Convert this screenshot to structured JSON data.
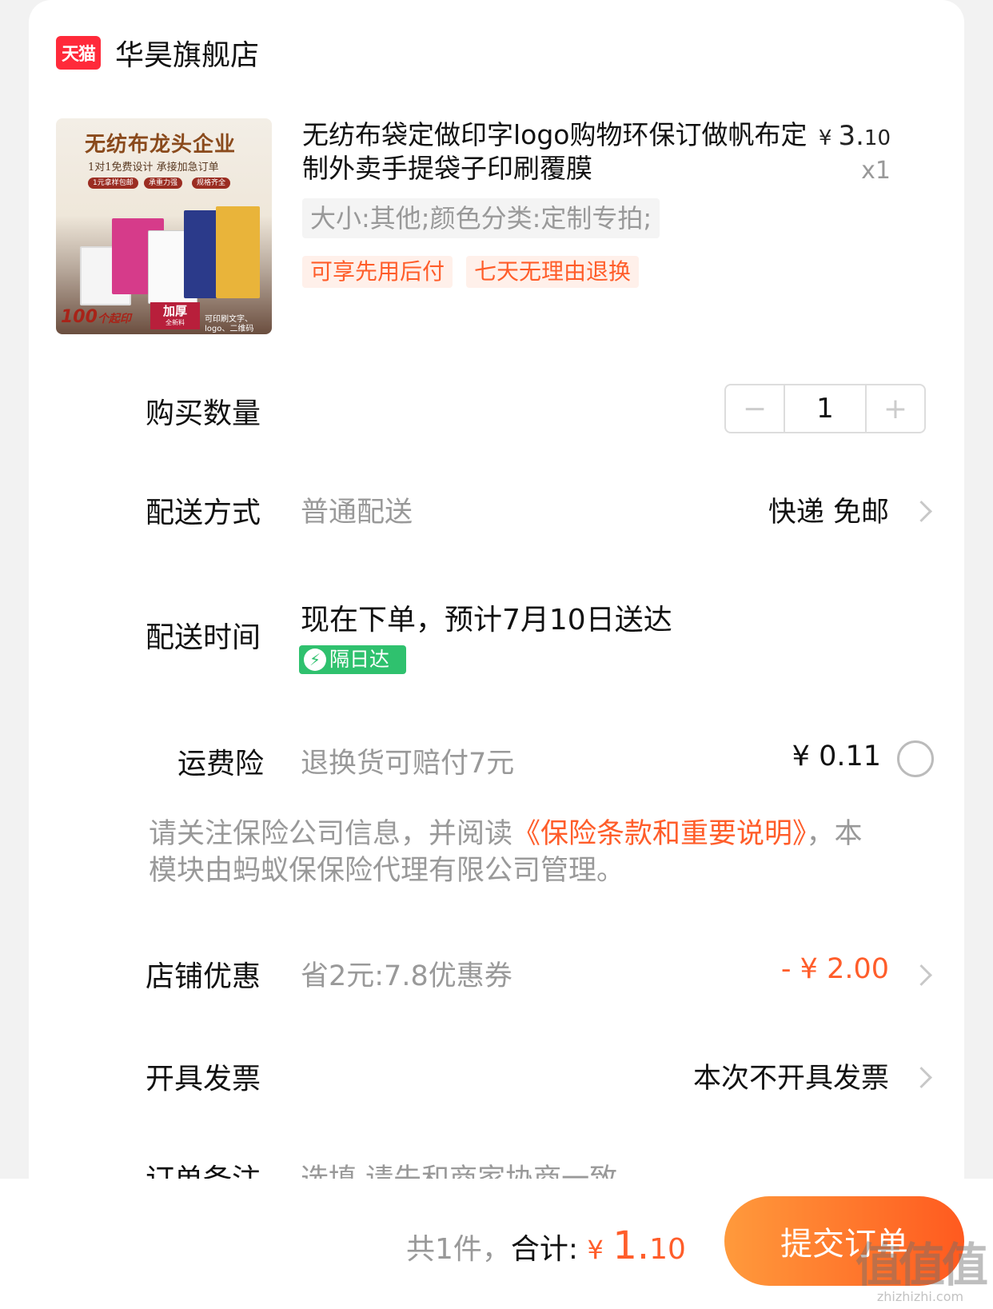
{
  "shop": {
    "logo_text": "天猫",
    "name": "华昊旗舰店"
  },
  "product": {
    "title": "无纺布袋定做印字logo购物环保订做帆布定制外卖手提袋子印刷覆膜",
    "price_yen": "¥",
    "price_int": "3.",
    "price_dec": "10",
    "quantity_label": "x1",
    "sku": "大小:其他;颜色分类:定制专拍;",
    "tags": [
      "可享先用后付",
      "七天无理由退换"
    ],
    "thumbnail": {
      "headline": "无纺布龙头企业",
      "subline": "1对1免费设计  承接加急订单",
      "pills": [
        "1元拿样包邮",
        "承重力强",
        "规格齐全"
      ],
      "min_order": "100",
      "min_order_unit": "个起印",
      "thick": "加厚",
      "thick_sub": "全新料",
      "print_note": "可印刷文字、logo、二维码"
    }
  },
  "rows": {
    "quantity": {
      "label": "购买数量",
      "value": "1",
      "minus": "−",
      "plus": "+"
    },
    "shipping": {
      "label": "配送方式",
      "sub": "普通配送",
      "value": "快递 免邮"
    },
    "delivery_time": {
      "label": "配送时间",
      "value": "现在下单，预计7月10日送达",
      "badge": "隔日达"
    },
    "insurance": {
      "label": "运费险",
      "sub": "退换货可赔付7元",
      "value": "¥ 0.11"
    },
    "notice": {
      "text_before": "请关注保险公司信息，并阅读",
      "link": "《保险条款和重要说明》",
      "text_after": "，本模块由蚂蚁保保险代理有限公司管理。"
    },
    "coupon": {
      "label": "店铺优惠",
      "sub": "省2元:7.8优惠券",
      "value": "- ¥ 2.00"
    },
    "invoice": {
      "label": "开具发票",
      "value": "本次不开具发票"
    },
    "remark": {
      "label": "订单备注",
      "placeholder": "选填,请先和商家协商一致"
    }
  },
  "footer": {
    "count_text": "共1件，",
    "total_label": "合计:",
    "total_yen": "¥",
    "total_int": "1.",
    "total_dec": "10",
    "submit_label": "提交订单"
  },
  "watermark": {
    "logo": "值值值",
    "url": "zhizhizhi.com"
  },
  "colors": {
    "accent": "#ff5d2a",
    "green": "#2fc16e",
    "tmall": "#ff2a3a"
  }
}
